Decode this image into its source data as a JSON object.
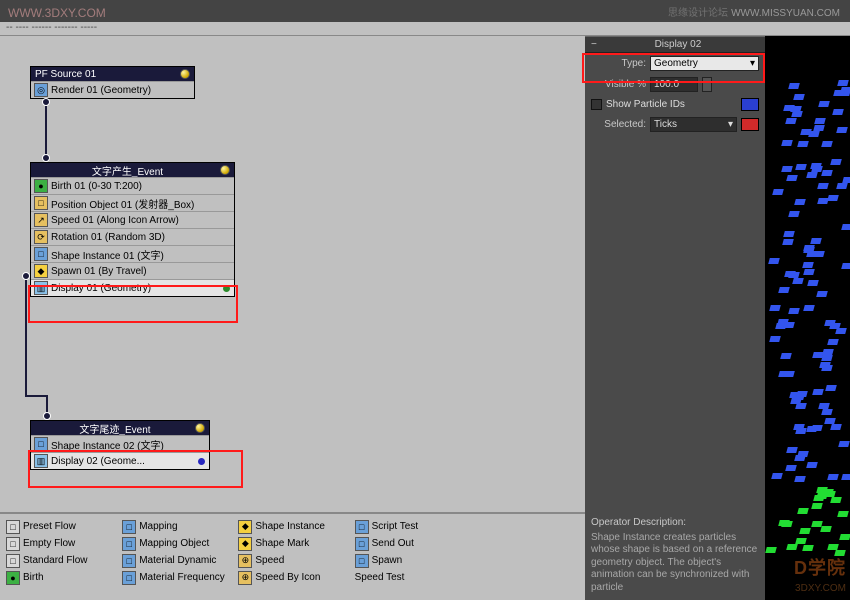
{
  "watermarks": {
    "tl": "WWW.3DXY.COM",
    "tr_cn": "思缘设计论坛",
    "tr_url": "WWW.MISSYUAN.COM",
    "br1": "D学院",
    "br2": "3DXY.COM"
  },
  "menubar": "--  ----  ------  -------  -----",
  "source_node": {
    "title": "PF Source 01",
    "render": "Render 01 (Geometry)"
  },
  "event1": {
    "title": "文字产生_Event",
    "ops": [
      {
        "icon": "●",
        "bg": "#3cb043",
        "text": "Birth 01 (0-30 T:200)"
      },
      {
        "icon": "□",
        "bg": "#e6c060",
        "text": "Position Object 01 (发射器_Box)"
      },
      {
        "icon": "↗",
        "bg": "#e6c060",
        "text": "Speed 01 (Along Icon Arrow)"
      },
      {
        "icon": "⟳",
        "bg": "#e6c060",
        "text": "Rotation 01 (Random 3D)"
      },
      {
        "icon": "□",
        "bg": "#6aa0d8",
        "text": "Shape Instance 01 (文字)"
      },
      {
        "icon": "◆",
        "bg": "#f5d040",
        "text": "Spawn 01 (By Travel)",
        "spawn": true
      },
      {
        "icon": "▥",
        "bg": "#8ac1e8",
        "text": "Display 01 (Geometry)",
        "hot": true,
        "dot": "green"
      }
    ]
  },
  "event2": {
    "title": "文字尾迹_Event",
    "ops": [
      {
        "icon": "□",
        "bg": "#6aa0d8",
        "text": "Shape Instance 02 (文字)"
      },
      {
        "icon": "▥",
        "bg": "#8ac1e8",
        "text": "Display 02 (Geome...",
        "hot": true,
        "dot": "blue"
      }
    ]
  },
  "depot": [
    {
      "i": "□",
      "bg": "#d8d8d8",
      "t": "Preset Flow"
    },
    {
      "i": "□",
      "bg": "#6aa0d8",
      "t": "Mapping"
    },
    {
      "i": "◆",
      "bg": "#f5d040",
      "t": "Shape Instance"
    },
    {
      "i": "□",
      "bg": "#6aa0d8",
      "t": "Script Test"
    },
    {
      "i": "",
      "bg": "",
      "t": ""
    },
    {
      "i": "□",
      "bg": "#d8d8d8",
      "t": "Empty Flow"
    },
    {
      "i": "□",
      "bg": "#6aa0d8",
      "t": "Mapping Object"
    },
    {
      "i": "◆",
      "bg": "#f5d040",
      "t": "Shape Mark"
    },
    {
      "i": "□",
      "bg": "#6aa0d8",
      "t": "Send Out"
    },
    {
      "i": "",
      "bg": "",
      "t": ""
    },
    {
      "i": "□",
      "bg": "#d8d8d8",
      "t": "Standard Flow"
    },
    {
      "i": "□",
      "bg": "#6aa0d8",
      "t": "Material Dynamic"
    },
    {
      "i": "⊕",
      "bg": "#e6c060",
      "t": "Speed"
    },
    {
      "i": "□",
      "bg": "#6aa0d8",
      "t": "Spawn"
    },
    {
      "i": "",
      "bg": "",
      "t": ""
    },
    {
      "i": "●",
      "bg": "#3cb043",
      "t": "Birth"
    },
    {
      "i": "□",
      "bg": "#6aa0d8",
      "t": "Material Frequency"
    },
    {
      "i": "⊕",
      "bg": "#e6c060",
      "t": "Speed By Icon"
    },
    {
      "i": "",
      "bg": "",
      "t": "Speed Test"
    },
    {
      "i": "",
      "bg": "",
      "t": ""
    }
  ],
  "rollout": {
    "title": "Display 02",
    "type_lab": "Type:",
    "type_val": "Geometry",
    "vis_lab": "Visible %",
    "vis_val": "100.0",
    "show_ids": "Show Particle IDs",
    "sel_lab": "Selected:",
    "sel_val": "Ticks",
    "opdesc_title": "Operator Description:",
    "opdesc_body": "Shape Instance creates particles whose shape is based on a reference geometry object. The object's animation can be synchronized with particle"
  }
}
